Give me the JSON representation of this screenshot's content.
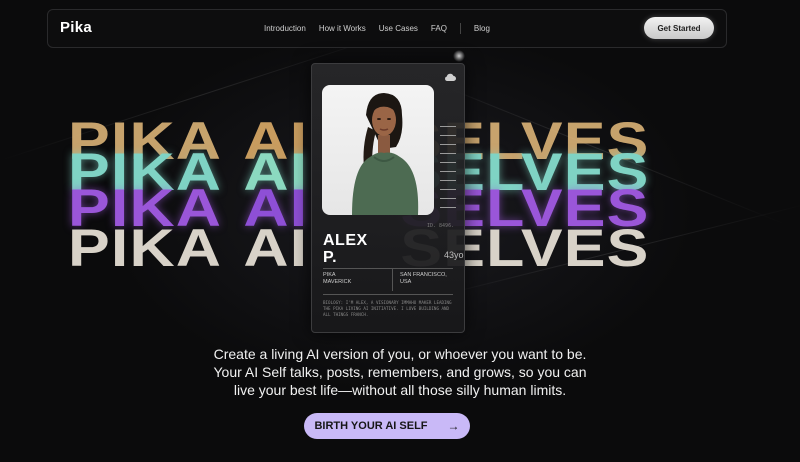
{
  "nav": {
    "logo": "Pika",
    "links": [
      "Introduction",
      "How it Works",
      "Use Cases",
      "FAQ",
      "Blog"
    ],
    "cta": "Get Started"
  },
  "hero": {
    "title_left": "PIKA",
    "title_mid": "AI",
    "title_right": "SELVES",
    "rows": 4,
    "row_colors": [
      "#e7bd7d",
      "#7fd3c4",
      "#9a56d9",
      "#d8d2c8"
    ]
  },
  "card": {
    "name_line1": "ALEX",
    "name_line2": "P.",
    "id_text": "ID. 8496.",
    "age": "43yo",
    "meta_left": [
      "PIKA",
      "MAVERICK"
    ],
    "meta_right": [
      "SAN FRANCISCO,",
      "USA"
    ],
    "bio": "BIOLOGY: I'M ALEX, A VISIONARY IMMAHO MAKER LEADING THE PIKA LIVING AI INITIATIVE. I LOVE BUILDING AND ALL THINGS FRANCH.",
    "icon": "cloud-icon"
  },
  "description": {
    "line1": "Create a living AI version of you, or whoever you want to be.",
    "line2": "Your AI Self talks, posts, remembers, and grows, so you can",
    "line3": "live your best life—without all those silly human limits."
  },
  "button": {
    "label": "BIRTH YOUR AI SELF",
    "arrow": "→",
    "color": "#c9b9f7"
  }
}
